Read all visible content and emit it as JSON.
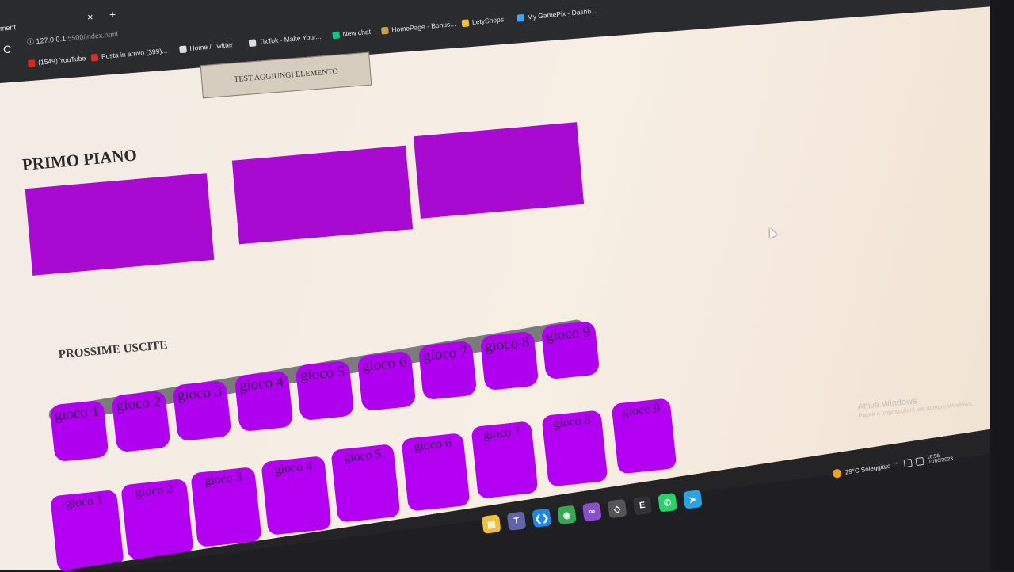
{
  "browser": {
    "tab_title": "ment",
    "tab_close": "×",
    "new_tab": "+",
    "reload": "C",
    "url_host": "127.0.0.1",
    "url_path": ":5500/index.html",
    "bookmarks": [
      {
        "label": "(1549) YouTube",
        "icon": "youtube-icon",
        "color": "#e62117"
      },
      {
        "label": "Posta in arrivo (399)...",
        "icon": "gmail-icon",
        "color": "#d93025"
      },
      {
        "label": "Home / Twitter",
        "icon": "x-icon",
        "color": "#dddddd"
      },
      {
        "label": "TikTok - Make Your...",
        "icon": "tiktok-icon",
        "color": "#dddddd"
      },
      {
        "label": "New chat",
        "icon": "chatgpt-icon",
        "color": "#19c37d"
      },
      {
        "label": "HomePage - Bonus...",
        "icon": "globe-icon",
        "color": "#c8a24a"
      },
      {
        "label": "LetyShops",
        "icon": "letyshops-icon",
        "color": "#f4c21a"
      },
      {
        "label": "My GamePix - Dashb...",
        "icon": "gamepix-icon",
        "color": "#3da3ff"
      }
    ]
  },
  "page": {
    "button_label": "TEST AGGIUNGI ELEMENTO",
    "primo_heading": "PRIMO PIANO",
    "prossime_heading": "PROSSIME USCITE",
    "row1_cards": [
      "gioco 1",
      "gioco 2",
      "gioco 3",
      "gioco 4",
      "gioco 5",
      "gioco 6",
      "gioco 7",
      "gioco 8",
      "gioco 9"
    ],
    "row2_cards": [
      "gioco 1",
      "gioco 2",
      "gioco 3",
      "gioco 4",
      "gioco 5",
      "gioco 6",
      "gioco 7",
      "gioco 8",
      "gioco 9"
    ]
  },
  "watermark": {
    "line1": "Attiva Windows",
    "line2": "Passa a Impostazioni per attivare Windows."
  },
  "taskbar": {
    "weather": "29°C Soleggiato",
    "time": "16:56",
    "date": "01/06/2023",
    "apps": [
      {
        "name": "file-explorer-icon",
        "color": "#f0c03a",
        "glyph": "▤"
      },
      {
        "name": "teams-icon",
        "color": "#6264a7",
        "glyph": "T"
      },
      {
        "name": "vscode-icon",
        "color": "#1e88e5",
        "glyph": "❮❯"
      },
      {
        "name": "chrome-icon",
        "color": "#34a853",
        "glyph": "◉"
      },
      {
        "name": "visual-studio-icon",
        "color": "#8a4fcf",
        "glyph": "∞"
      },
      {
        "name": "unity-icon",
        "color": "#555555",
        "glyph": "◇"
      },
      {
        "name": "epic-games-icon",
        "color": "#333333",
        "glyph": "E"
      },
      {
        "name": "whatsapp-icon",
        "color": "#25d366",
        "glyph": "✆"
      },
      {
        "name": "telegram-icon",
        "color": "#2aa3df",
        "glyph": "➤"
      }
    ]
  },
  "colors": {
    "accent_purple": "#b000f0",
    "track_gray": "#7b7b7b"
  }
}
